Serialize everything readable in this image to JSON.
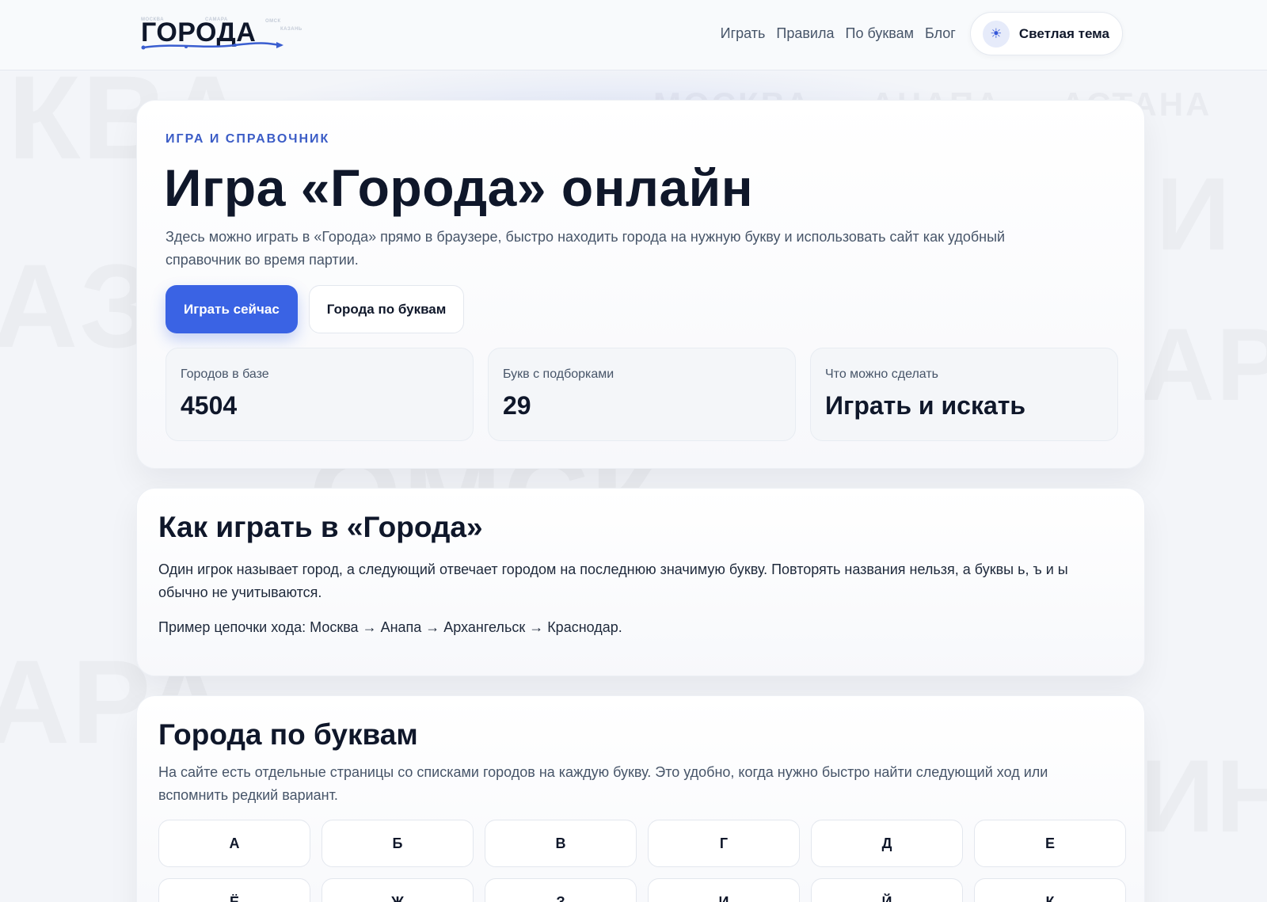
{
  "background": {
    "words": [
      "КВА",
      "АЗ",
      "АРА",
      "ОМСК",
      "И",
      "АР",
      "ИН"
    ],
    "chain": "МОСКВА → АНАПА → АСТАНА"
  },
  "header": {
    "logo": {
      "text": "ГОРОДА",
      "mini": [
        "МОСКВА",
        "САМАРА",
        "ОМСК",
        "КАЗАНЬ"
      ]
    },
    "nav": [
      "Играть",
      "Правила",
      "По буквам",
      "Блог"
    ],
    "theme": {
      "icon": "☀",
      "label": "Светлая тема"
    }
  },
  "hero": {
    "eyebrow": "ИГРА И СПРАВОЧНИК",
    "title": "Игра «Города» онлайн",
    "description": "Здесь можно играть в «Города» прямо в браузере, быстро находить города на нужную букву и использовать сайт как удобный справочник во время партии.",
    "primary_button": "Играть сейчас",
    "secondary_button": "Города по буквам",
    "stats": [
      {
        "label": "Городов в базе",
        "value": "4504"
      },
      {
        "label": "Букв с подборками",
        "value": "29"
      },
      {
        "label": "Что можно сделать",
        "value": "Играть и искать"
      }
    ]
  },
  "how": {
    "title": "Как играть в «Города»",
    "text": "Один игрок называет город, а следующий отвечает городом на последнюю значимую букву. Повторять названия нельзя, а буквы ь, ъ и ы обычно не учитываются.",
    "example": "Пример цепочки хода: Москва → Анапа → Архангельск → Краснодар."
  },
  "letters": {
    "title": "Города по буквам",
    "description": "На сайте есть отдельные страницы со списками городов на каждую букву. Это удобно, когда нужно быстро найти следующий ход или вспомнить редкий вариант.",
    "items": [
      "А",
      "Б",
      "В",
      "Г",
      "Д",
      "Е",
      "Ё",
      "Ж",
      "З",
      "И",
      "Й",
      "К"
    ]
  },
  "colors": {
    "accent": "#3a63e4",
    "eyebrow": "#3b5cc6",
    "text": "#0f172a",
    "muted": "#475569"
  }
}
